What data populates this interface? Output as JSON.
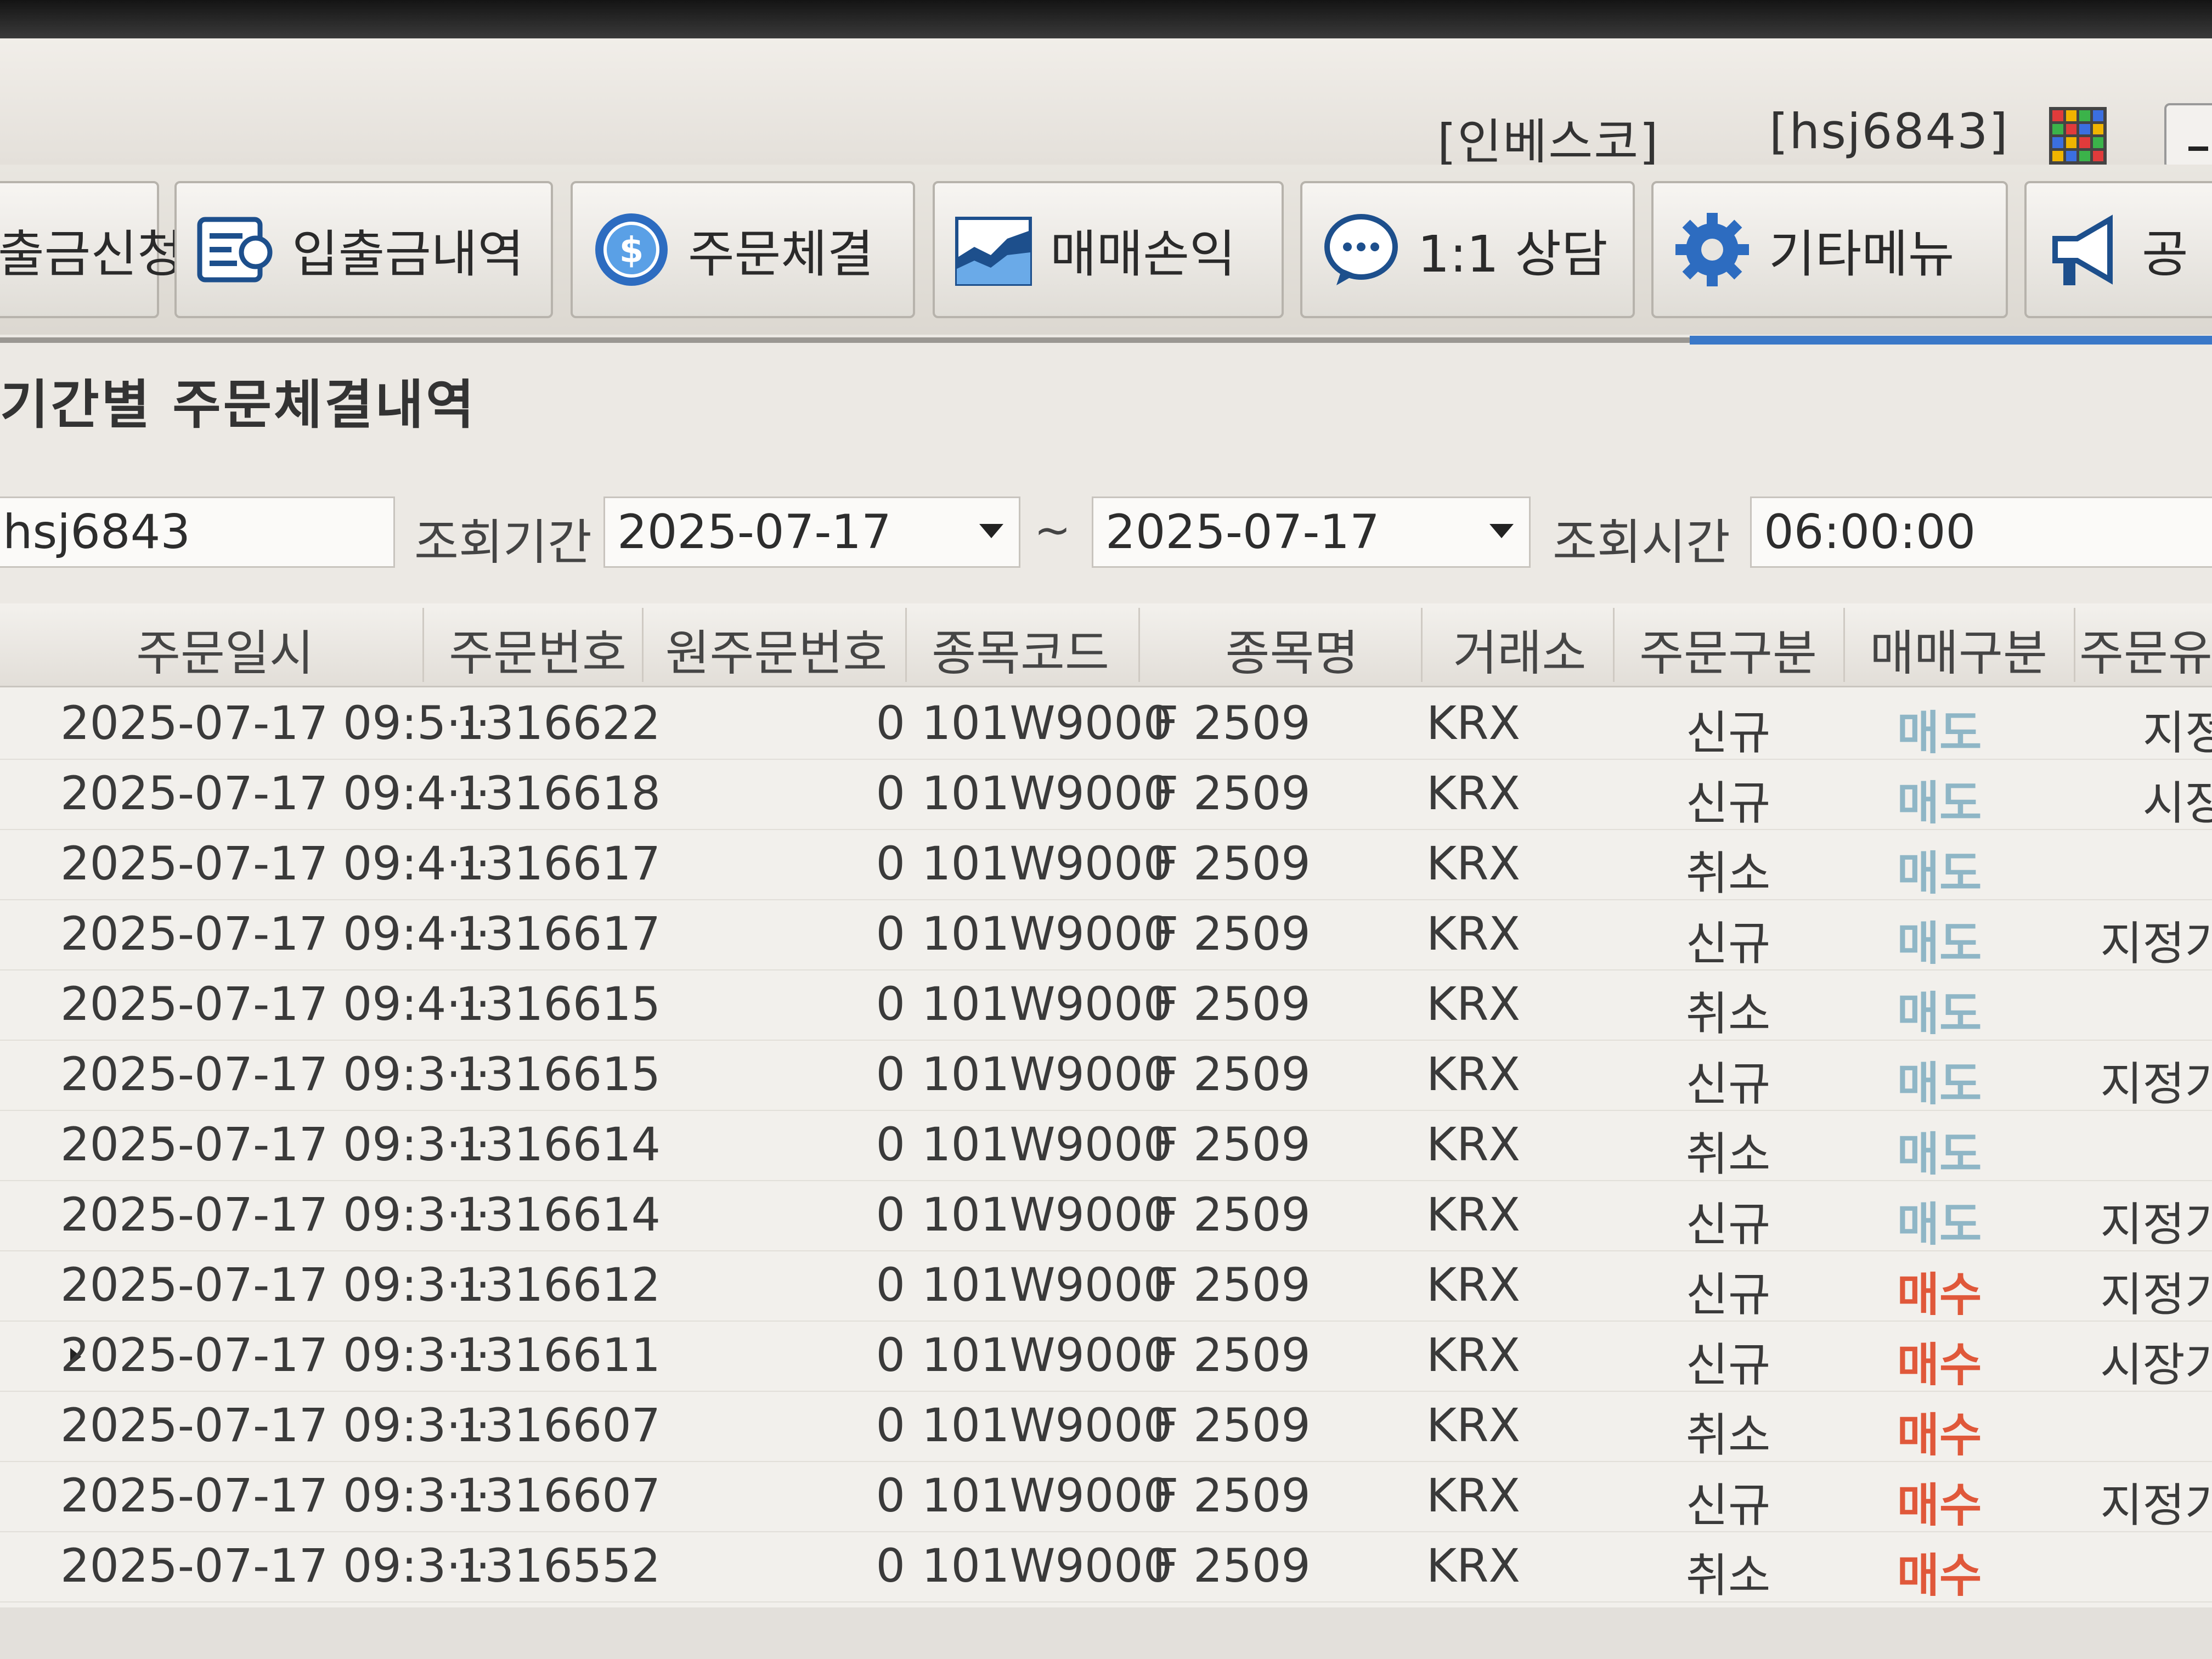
{
  "titlebar": {
    "company": "[인베스코]",
    "user": "[hsj6843]"
  },
  "toolbar": {
    "buttons": [
      {
        "label": "출금신청",
        "icon": "withdraw-icon"
      },
      {
        "label": "입출금내역",
        "icon": "list-icon"
      },
      {
        "label": "주문체결",
        "icon": "coin-icon"
      },
      {
        "label": "매매손익",
        "icon": "area-chart-icon"
      },
      {
        "label": "1:1 상담",
        "icon": "chat-icon"
      },
      {
        "label": "기타메뉴",
        "icon": "gear-icon"
      },
      {
        "label": "공",
        "icon": "megaphone-icon"
      }
    ]
  },
  "section": {
    "title": "기간별 주문체결내역"
  },
  "filters": {
    "account": "hsj6843",
    "period_label": "조회기간",
    "date_from": "2025-07-17",
    "tilde": "~",
    "date_to": "2025-07-17",
    "time_label": "조회시간",
    "time_value": "06:00:00"
  },
  "grid": {
    "columns": [
      "주문일시",
      "주문번호",
      "원주문번호",
      "종목코드",
      "종목명",
      "거래소",
      "주문구분",
      "매매구분",
      "주문유"
    ],
    "rows": [
      {
        "date": "2025-07-17 09:5···",
        "order_no": "1316622",
        "orig_no": "0",
        "code": "101W9000",
        "name": "F 2509",
        "exch": "KRX",
        "type": "신규",
        "side": "매도",
        "price_type": "지정"
      },
      {
        "date": "2025-07-17 09:4···",
        "order_no": "1316618",
        "orig_no": "0",
        "code": "101W9000",
        "name": "F 2509",
        "exch": "KRX",
        "type": "신규",
        "side": "매도",
        "price_type": "시장"
      },
      {
        "date": "2025-07-17 09:4···",
        "order_no": "1316617",
        "orig_no": "0",
        "code": "101W9000",
        "name": "F 2509",
        "exch": "KRX",
        "type": "취소",
        "side": "매도",
        "price_type": ""
      },
      {
        "date": "2025-07-17 09:4···",
        "order_no": "1316617",
        "orig_no": "0",
        "code": "101W9000",
        "name": "F 2509",
        "exch": "KRX",
        "type": "신규",
        "side": "매도",
        "price_type": "지정가"
      },
      {
        "date": "2025-07-17 09:4···",
        "order_no": "1316615",
        "orig_no": "0",
        "code": "101W9000",
        "name": "F 2509",
        "exch": "KRX",
        "type": "취소",
        "side": "매도",
        "price_type": ""
      },
      {
        "date": "2025-07-17 09:3···",
        "order_no": "1316615",
        "orig_no": "0",
        "code": "101W9000",
        "name": "F 2509",
        "exch": "KRX",
        "type": "신규",
        "side": "매도",
        "price_type": "지정가"
      },
      {
        "date": "2025-07-17 09:3···",
        "order_no": "1316614",
        "orig_no": "0",
        "code": "101W9000",
        "name": "F 2509",
        "exch": "KRX",
        "type": "취소",
        "side": "매도",
        "price_type": ""
      },
      {
        "date": "2025-07-17 09:3···",
        "order_no": "1316614",
        "orig_no": "0",
        "code": "101W9000",
        "name": "F 2509",
        "exch": "KRX",
        "type": "신규",
        "side": "매도",
        "price_type": "지정가"
      },
      {
        "date": "2025-07-17 09:3···",
        "order_no": "1316612",
        "orig_no": "0",
        "code": "101W9000",
        "name": "F 2509",
        "exch": "KRX",
        "type": "신규",
        "side": "매수",
        "price_type": "지정가"
      },
      {
        "date": "2025-07-17 09:3···",
        "order_no": "1316611",
        "orig_no": "0",
        "code": "101W9000",
        "name": "F 2509",
        "exch": "KRX",
        "type": "신규",
        "side": "매수",
        "price_type": "시장가",
        "selected": true
      },
      {
        "date": "2025-07-17 09:3···",
        "order_no": "1316607",
        "orig_no": "0",
        "code": "101W9000",
        "name": "F 2509",
        "exch": "KRX",
        "type": "취소",
        "side": "매수",
        "price_type": ""
      },
      {
        "date": "2025-07-17 09:3···",
        "order_no": "1316607",
        "orig_no": "0",
        "code": "101W9000",
        "name": "F 2509",
        "exch": "KRX",
        "type": "신규",
        "side": "매수",
        "price_type": "지정가"
      },
      {
        "date": "2025-07-17 09:3···",
        "order_no": "1316552",
        "orig_no": "0",
        "code": "101W9000",
        "name": "F 2509",
        "exch": "KRX",
        "type": "취소",
        "side": "매수",
        "price_type": ""
      }
    ]
  },
  "colors": {
    "sell": "#8fb6c6",
    "buy": "#e0583a",
    "accent": "#3a78c8"
  }
}
